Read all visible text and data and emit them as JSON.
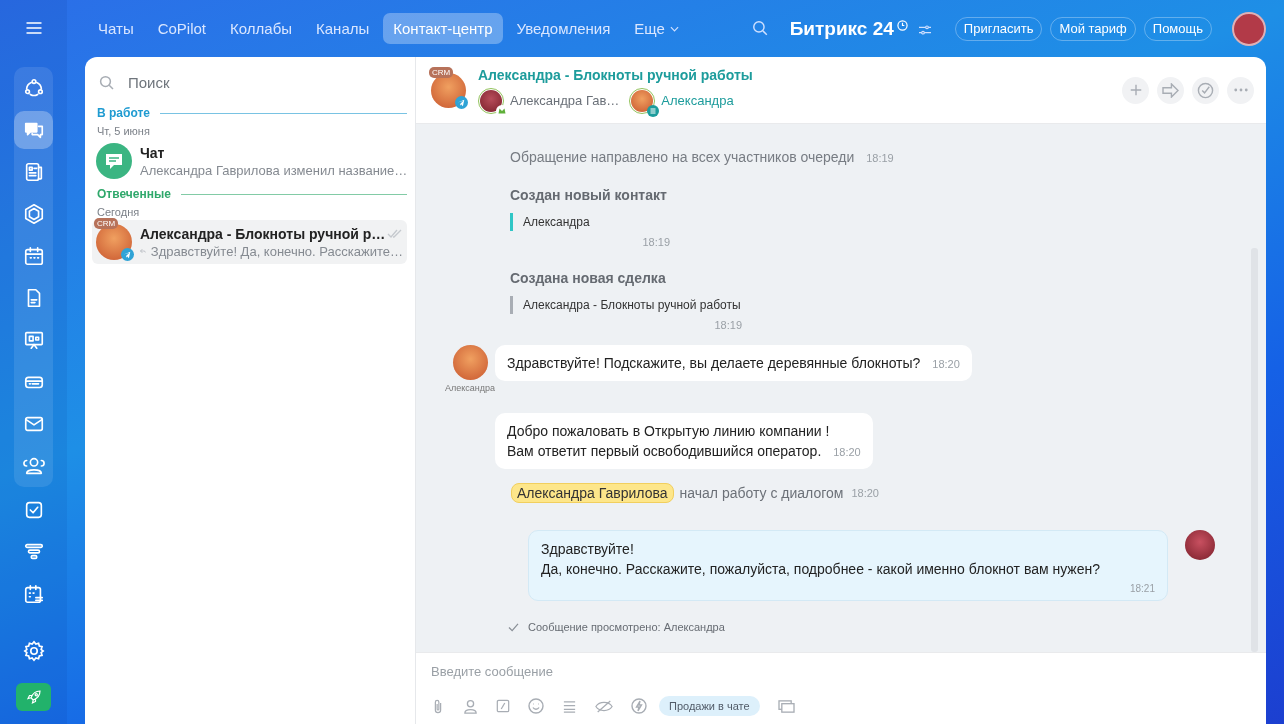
{
  "nav": [
    {
      "label": "Чаты",
      "selected": false,
      "dropdown": false
    },
    {
      "label": "CoPilot",
      "selected": false,
      "dropdown": false
    },
    {
      "label": "Коллабы",
      "selected": false,
      "dropdown": false
    },
    {
      "label": "Каналы",
      "selected": false,
      "dropdown": false
    },
    {
      "label": "Контакт-центр",
      "selected": true,
      "dropdown": false
    },
    {
      "label": "Уведомления",
      "selected": false,
      "dropdown": false
    },
    {
      "label": "Еще",
      "selected": false,
      "dropdown": true
    }
  ],
  "logo": {
    "name": "Битрикс",
    "number": "24"
  },
  "header_buttons": [
    "Пригласить",
    "Мой тариф",
    "Помощь"
  ],
  "rail": {
    "grouped": [
      {
        "kind": "flow",
        "selected": false
      },
      {
        "kind": "chat",
        "selected": true
      },
      {
        "kind": "feed",
        "selected": false
      },
      {
        "kind": "hexagon",
        "selected": false
      },
      {
        "kind": "calendar",
        "selected": false
      },
      {
        "kind": "doc",
        "selected": false
      },
      {
        "kind": "board",
        "selected": false
      },
      {
        "kind": "drive",
        "selected": false
      },
      {
        "kind": "mail",
        "selected": false
      },
      {
        "kind": "people",
        "selected": false
      }
    ],
    "other": [
      {
        "kind": "tasks",
        "selected": false
      },
      {
        "kind": "funnel",
        "selected": false
      },
      {
        "kind": "planner",
        "selected": false
      }
    ]
  },
  "recent": {
    "search_placeholder": "Поиск",
    "sections": [
      {
        "title": "В работе",
        "color": "#1f9bd1",
        "date": "Чт, 5 июня",
        "items": [
          {
            "kind": "chat",
            "title": "Чат",
            "preview": "Александра Гаврилова изменил название…",
            "replied": false,
            "read": false,
            "selected": false
          }
        ]
      },
      {
        "title": "Отвеченные",
        "color": "#2fa86b",
        "date": "Сегодня",
        "items": [
          {
            "kind": "client",
            "title": "Александра - Блокноты ручной р…",
            "preview": "Здравствуйте! Да, конечно. Расскажите…",
            "badge": "CRM",
            "replied": true,
            "read": true,
            "selected": true
          }
        ]
      }
    ]
  },
  "dialog": {
    "badge": "CRM",
    "title": "Александра - Блокноты ручной работы",
    "members": [
      {
        "kind": "operator",
        "name": "Александра Гав…"
      },
      {
        "kind": "client",
        "name": "Александра"
      }
    ]
  },
  "messages": [
    {
      "kind": "system",
      "text": "Обращение направлено на всех участников очереди",
      "time": "18:19"
    },
    {
      "kind": "entity",
      "title": "Создан новый контакт",
      "value": "Александра",
      "time": "18:19",
      "color": "#2fc6c6"
    },
    {
      "kind": "entity",
      "title": "Создана новая сделка",
      "value": "Александра - Блокноты ручной работы",
      "time": "18:19",
      "color": "#a8adb4"
    },
    {
      "kind": "incoming",
      "author": "Александра",
      "lines": [
        "Здравствуйте! Подскажите, вы делаете деревянные блокноты?"
      ],
      "time": "18:20"
    },
    {
      "kind": "incoming",
      "lines": [
        "Добро пожаловать в Открытую линию компании !",
        "Вам ответит первый освободившийся оператор."
      ],
      "time": "18:20"
    },
    {
      "kind": "join",
      "name": "Александра Гаврилова",
      "text": "начал работу с диалогом",
      "time": "18:20"
    },
    {
      "kind": "outgoing",
      "lines": [
        "Здравствуйте!",
        "Да, конечно. Расскажите, пожалуйста, подробнее - какой именно блокнот вам нужен?"
      ],
      "time": "18:21"
    },
    {
      "kind": "seen",
      "text": "Сообщение просмотрено: Александра"
    }
  ],
  "composer": {
    "placeholder": "Введите сообщение",
    "chip": "Продажи в чате"
  }
}
